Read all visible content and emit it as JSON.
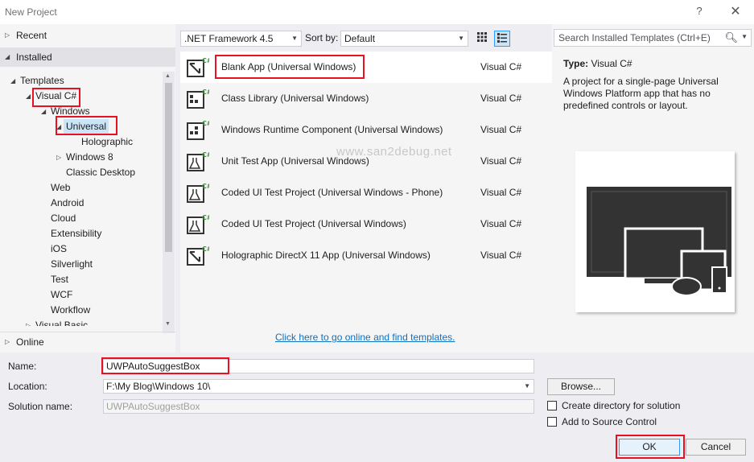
{
  "window": {
    "title": "New Project",
    "help_label": "?",
    "close_label": "✕"
  },
  "sidebar": {
    "recent_label": "Recent",
    "installed_label": "Installed",
    "online_label": "Online",
    "tree": [
      {
        "label": "Templates",
        "expander": "◢"
      },
      {
        "label": "Visual C#",
        "expander": "◢"
      },
      {
        "label": "Windows",
        "expander": "◢"
      },
      {
        "label": "Universal",
        "expander": "◢"
      },
      {
        "label": "Holographic",
        "expander": ""
      },
      {
        "label": "Windows 8",
        "expander": "▷"
      },
      {
        "label": "Classic Desktop",
        "expander": ""
      },
      {
        "label": "Web",
        "expander": ""
      },
      {
        "label": "Android",
        "expander": ""
      },
      {
        "label": "Cloud",
        "expander": ""
      },
      {
        "label": "Extensibility",
        "expander": ""
      },
      {
        "label": "iOS",
        "expander": ""
      },
      {
        "label": "Silverlight",
        "expander": ""
      },
      {
        "label": "Test",
        "expander": ""
      },
      {
        "label": "WCF",
        "expander": ""
      },
      {
        "label": "Workflow",
        "expander": ""
      },
      {
        "label": "Visual Basic",
        "expander": "▷"
      }
    ]
  },
  "toolbar": {
    "framework": ".NET Framework 4.5",
    "sort_label": "Sort by:",
    "sort_value": "Default"
  },
  "templates": [
    {
      "name": "Blank App (Universal Windows)",
      "language": "Visual C#"
    },
    {
      "name": "Class Library (Universal Windows)",
      "language": "Visual C#"
    },
    {
      "name": "Windows Runtime Component (Universal Windows)",
      "language": "Visual C#"
    },
    {
      "name": "Unit Test App (Universal Windows)",
      "language": "Visual C#"
    },
    {
      "name": "Coded UI Test Project (Universal Windows - Phone)",
      "language": "Visual C#"
    },
    {
      "name": "Coded UI Test Project (Universal Windows)",
      "language": "Visual C#"
    },
    {
      "name": "Holographic DirectX 11 App (Universal Windows)",
      "language": "Visual C#"
    }
  ],
  "online_link": "Click here to go online and find templates.",
  "search": {
    "placeholder": "Search Installed Templates (Ctrl+E)"
  },
  "details": {
    "type_label": "Type:",
    "type_value": "Visual C#",
    "description": "A project for a single-page Universal Windows Platform app that has no predefined controls or layout."
  },
  "watermark": "www.san2debug.net",
  "form": {
    "name_label": "Name:",
    "name_value": "UWPAutoSuggestBox",
    "location_label": "Location:",
    "location_value": "F:\\My Blog\\Windows 10\\",
    "solution_label": "Solution name:",
    "solution_value": "UWPAutoSuggestBox",
    "browse_label": "Browse...",
    "create_dir_label": "Create directory for solution",
    "add_source_label": "Add to Source Control",
    "ok_label": "OK",
    "cancel_label": "Cancel"
  },
  "colors": {
    "accent": "#3399ff",
    "highlight_box": "#e81123",
    "link": "#0e70c0"
  }
}
